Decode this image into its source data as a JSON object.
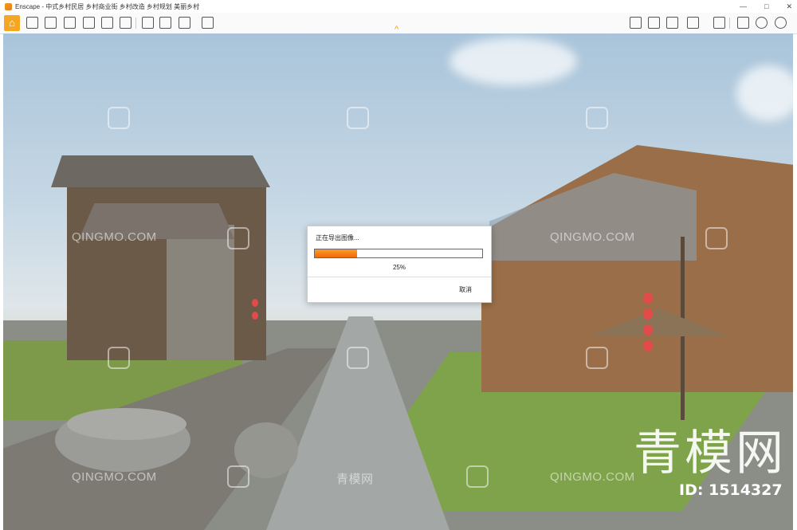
{
  "window": {
    "app_name": "Enscape",
    "title_path": "- 中式乡村民居 乡村商业街 乡村改造 乡村规划 美丽乡村",
    "minimize": "—",
    "maximize": "□",
    "close": "✕"
  },
  "toolbar": {
    "home_icon": "⌂",
    "collapse_chevron": "^"
  },
  "dialog": {
    "title": "正在导出图像...",
    "progress": 0.25,
    "progress_text": "25%",
    "cancel_label": "取消",
    "fill_color": "#f0800f"
  },
  "watermarks": {
    "site": "QINGMO.COM",
    "brand": "青模网",
    "brand_large": "青模网",
    "id_text": "ID: 1514327"
  }
}
